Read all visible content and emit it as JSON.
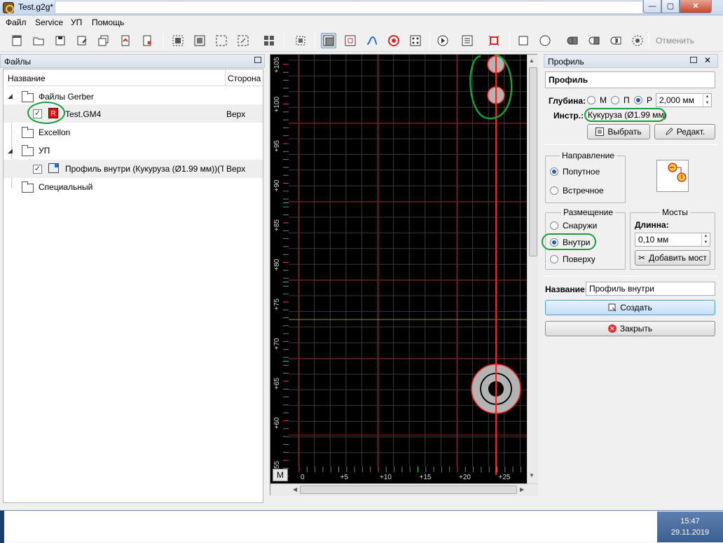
{
  "window": {
    "title": "Test.g2g*",
    "min": "—",
    "max": "▢",
    "close": "✕"
  },
  "menu": [
    "Файл",
    "Service",
    "УП",
    "Помощь"
  ],
  "toolbar": {
    "undo_label": "Отменить"
  },
  "files_panel": {
    "title": "Файлы",
    "col_name": "Название",
    "col_side": "Сторона",
    "rows": [
      {
        "label": "Файлы Gerber",
        "side": ""
      },
      {
        "label": "Test.GM4",
        "side": "Верх",
        "badge": "R"
      },
      {
        "label": "Excellon",
        "side": ""
      },
      {
        "label": "УП",
        "side": ""
      },
      {
        "label": "Профиль внутри (Кукуруза (Ø1.99 мм))(Т...",
        "side": "Верх"
      },
      {
        "label": "Специальный",
        "side": ""
      }
    ]
  },
  "canvas": {
    "y_ticks": [
      "+105",
      "+100",
      "+95",
      "+90",
      "+85",
      "+80",
      "+75",
      "+70",
      "+65",
      "+60",
      "55"
    ],
    "x_ticks": [
      "0",
      "+5",
      "+10",
      "+15",
      "+20",
      "+25"
    ],
    "corner_button": "M",
    "colors": {
      "grid": "#3a3a3a",
      "major": "#7a1b1b",
      "path": "#ff2020",
      "hole": "#b3b3b3"
    }
  },
  "profile_panel": {
    "title": "Профиль",
    "header": "Профиль",
    "depth_label": "Глубина:",
    "depth_options": [
      "М",
      "П",
      "Р"
    ],
    "depth_value": "2,000 мм",
    "tool_label": "Инстр.:",
    "tool_value": "Кукуруза (Ø1.99 мм)",
    "select_button": "Выбрать",
    "edit_button": "Редакт.",
    "direction": {
      "title": "Направление",
      "options": [
        "Попутное",
        "Встречное"
      ],
      "selected": 0
    },
    "placement": {
      "title": "Размещение",
      "options": [
        "Снаружи",
        "Внутри",
        "Поверху"
      ],
      "selected": 1
    },
    "bridges": {
      "title": "Мосты",
      "length_label": "Длинна:",
      "length_value": "0,10 мм",
      "add_button": "Добавить мост"
    },
    "name_label": "Название:",
    "name_value": "Профиль внутри",
    "create_button": "Создать",
    "close_button": "Закрыть"
  },
  "taskbar": {
    "time": "15:47",
    "date": "29.11.2019"
  }
}
